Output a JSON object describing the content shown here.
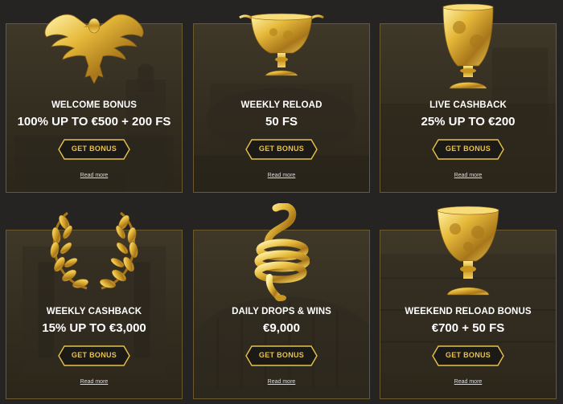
{
  "colors": {
    "gold": "#e8c24c",
    "card_border": "#6b5a2e",
    "page_bg": "#252422",
    "text": "#ffffff"
  },
  "cards": [
    {
      "title": "WELCOME BONUS",
      "amount": "100% UP TO €500 + 200 FS",
      "button": "GET BONUS",
      "link": "Read more",
      "art": "golden-eagle-icon"
    },
    {
      "title": "WEEKLY RELOAD",
      "amount": "50 FS",
      "button": "GET BONUS",
      "link": "Read more",
      "art": "golden-chalice-icon"
    },
    {
      "title": "LIVE CASHBACK",
      "amount": "25% UP TO €200",
      "button": "GET BONUS",
      "link": "Read more",
      "art": "golden-goblet-icon"
    },
    {
      "title": "WEEKLY CASHBACK",
      "amount": "15% UP TO €3,000",
      "button": "GET BONUS",
      "link": "Read more",
      "art": "laurel-wreath-icon"
    },
    {
      "title": "DAILY DROPS & WINS",
      "amount": "€9,000",
      "button": "GET BONUS",
      "link": "Read more",
      "art": "golden-snake-ring-icon"
    },
    {
      "title": "WEEKEND RELOAD BONUS",
      "amount": "€700 + 50 FS",
      "button": "GET BONUS",
      "link": "Read more",
      "art": "golden-cup-icon"
    }
  ]
}
